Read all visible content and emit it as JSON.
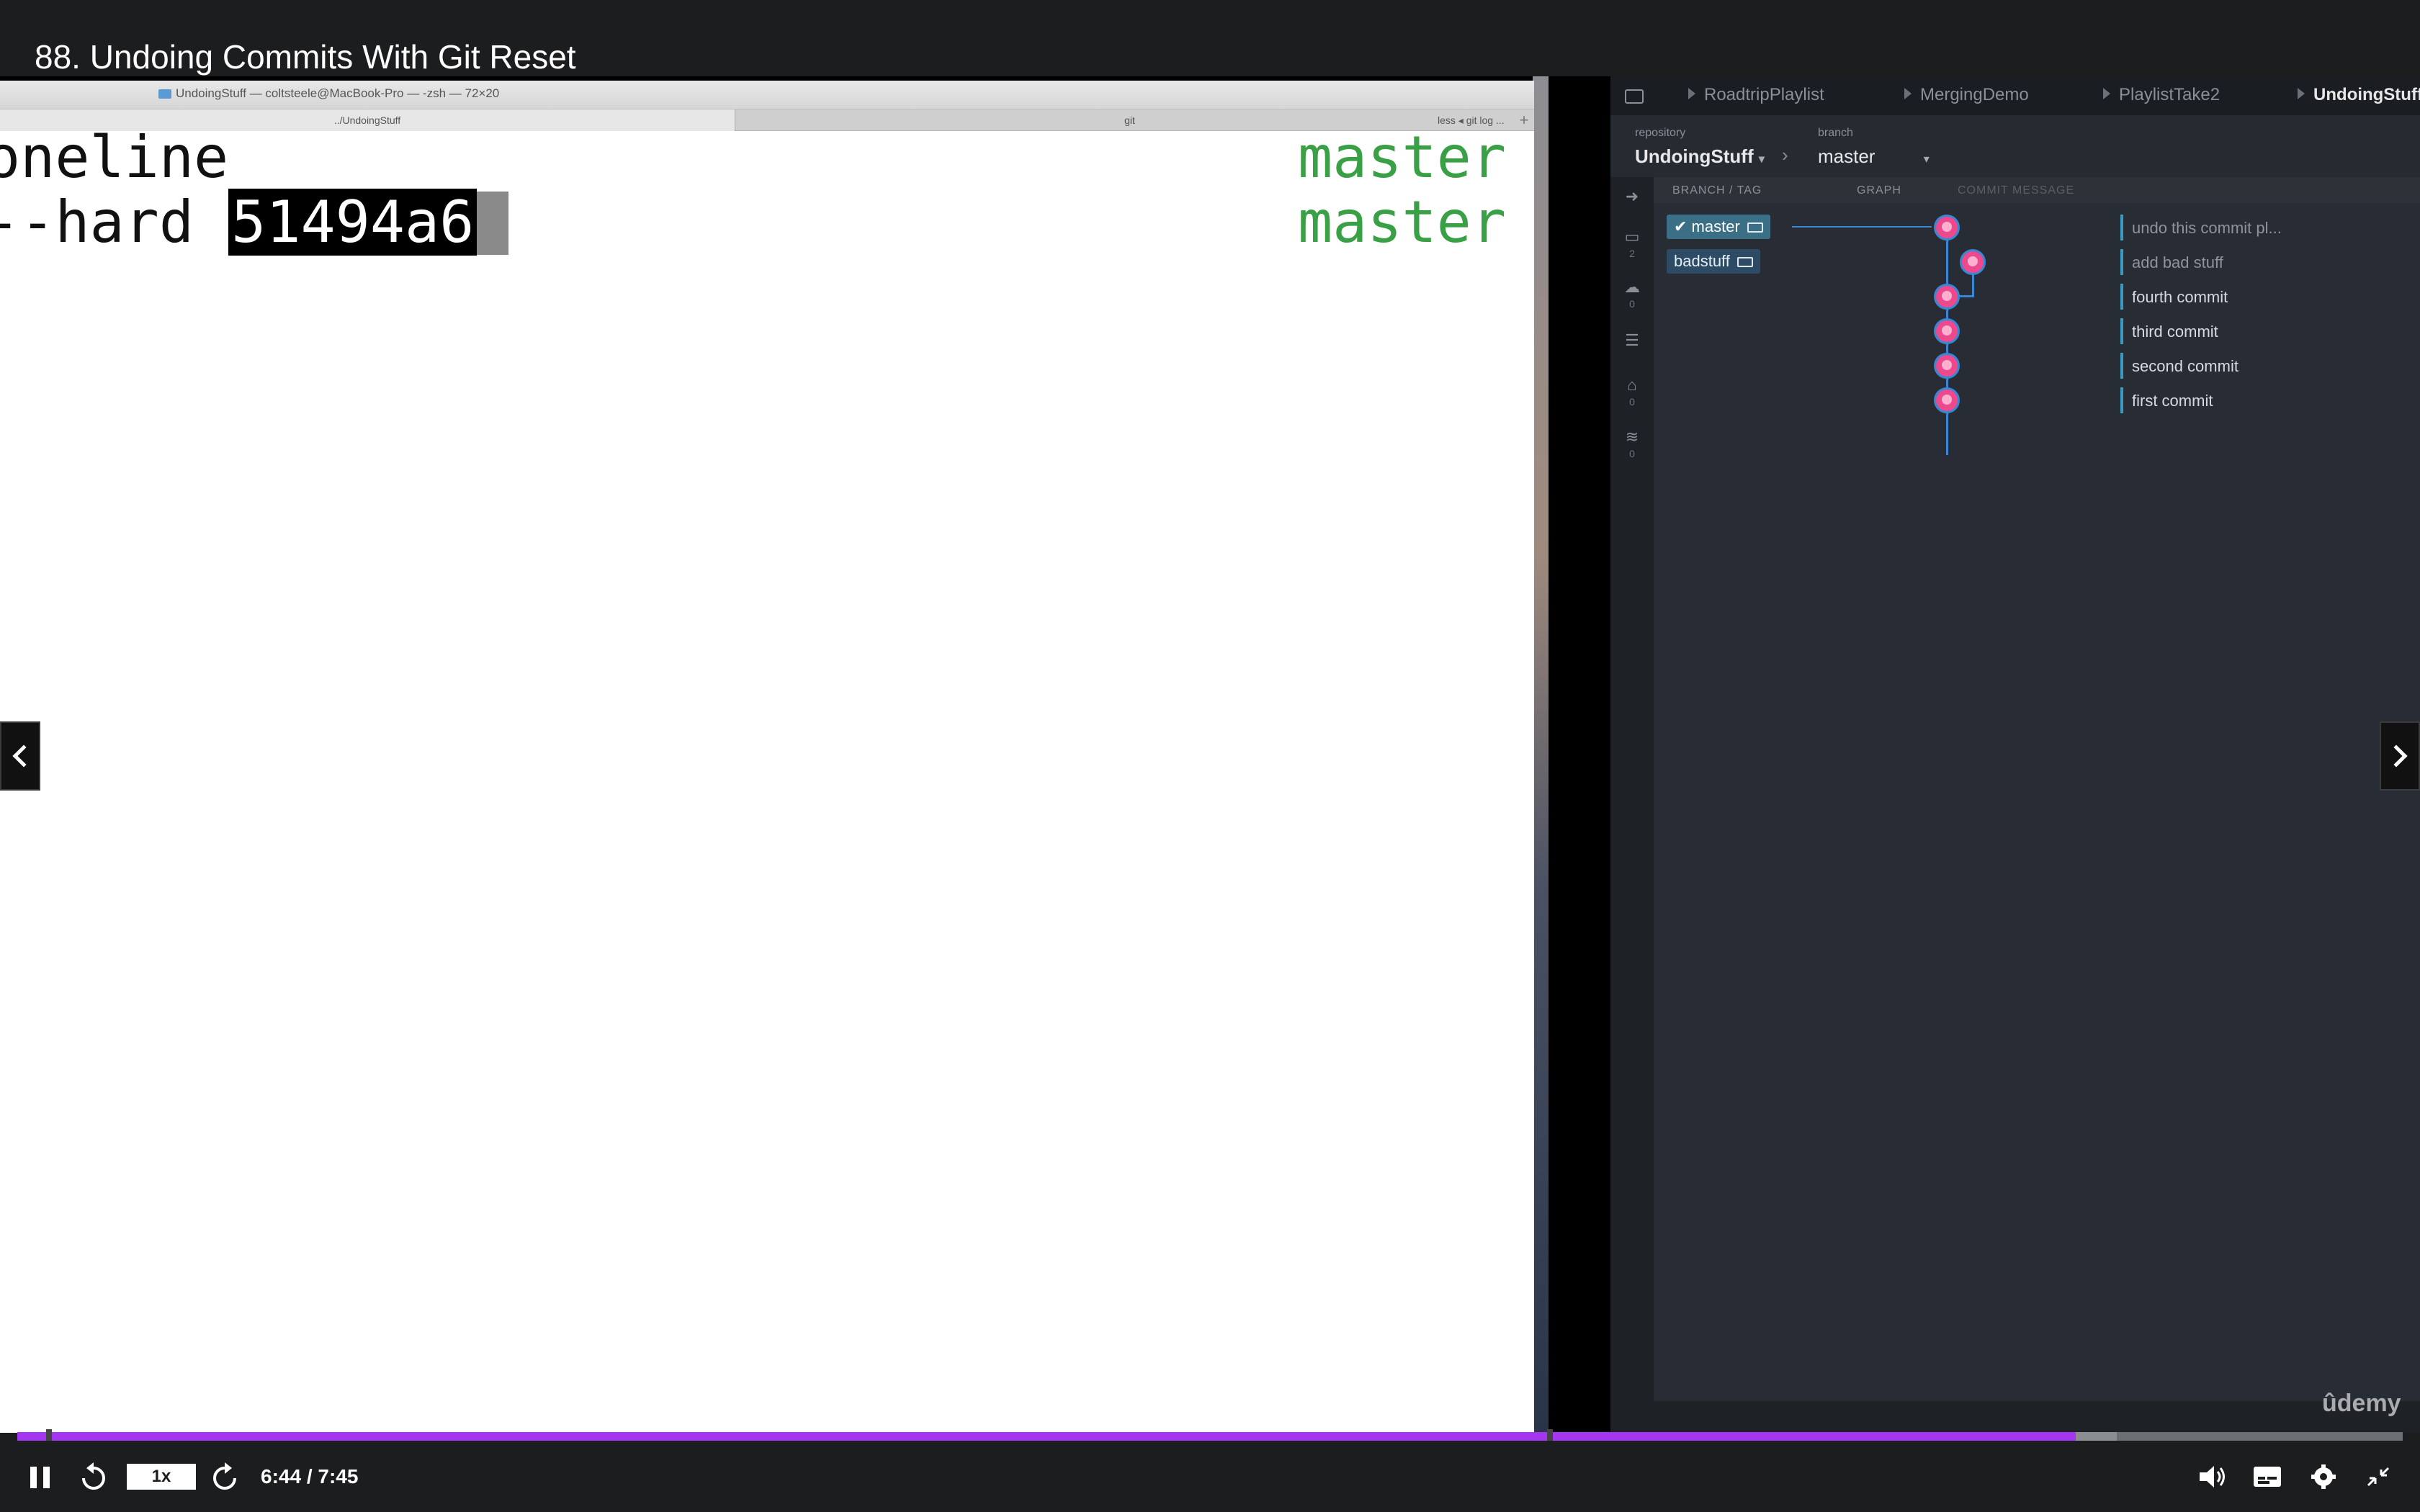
{
  "lecture": {
    "title": "88. Undoing Commits With Git Reset"
  },
  "terminal": {
    "window_title": "UndoingStuff — coltsteele@MacBook-Pro — -zsh — 72×20",
    "tabs": [
      "../UndoingStuff",
      "git",
      "less ◂ git log ...",
      "+"
    ],
    "line1": {
      "text": "oneline",
      "branch": "master"
    },
    "line2": {
      "prefix": "--hard ",
      "hash": "51494a6",
      "branch": "master"
    }
  },
  "gitgui": {
    "tabs": [
      "RoadtripPlaylist",
      "MergingDemo",
      "PlaylistTake2",
      "UndoingStuff"
    ],
    "repository_label": "repository",
    "repository": "UndoingStuff",
    "branch_label": "branch",
    "branch": "master",
    "columns": {
      "branch_tag": "BRANCH / TAG",
      "graph": "GRAPH",
      "commit_message": "COMMIT MESSAGE"
    },
    "branches": [
      "master",
      "badstuff"
    ],
    "commits": [
      "undo this commit pl...",
      "add bad stuff",
      "fourth commit",
      "third commit",
      "second commit",
      "first commit"
    ],
    "sidebar_counts": [
      "2",
      "0",
      "0",
      "0"
    ],
    "watermark": "ûdemy"
  },
  "player": {
    "progress_fraction": 0.863,
    "buffered_fraction": 0.88,
    "speed": "1x",
    "time": "6:44 / 7:45",
    "accent": "#a435f0"
  }
}
